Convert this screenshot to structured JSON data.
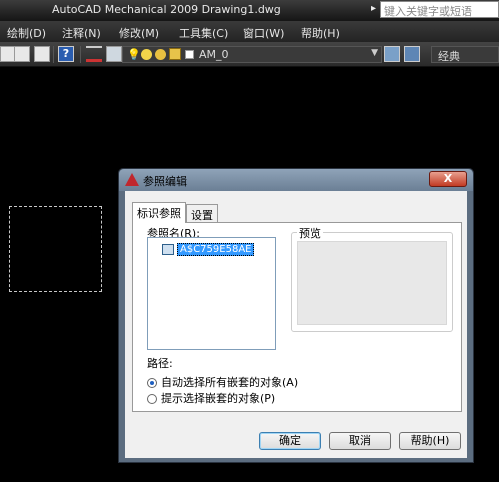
{
  "window": {
    "title": "AutoCAD Mechanical 2009 Drawing1.dwg",
    "search_placeholder": "键入关键字或短语"
  },
  "menubar": {
    "items": [
      "绘制(D)",
      "注释(N)",
      "修改(M)",
      "工具集(C)",
      "窗口(W)",
      "帮助(H)"
    ]
  },
  "toolbar": {
    "layer_name": "AM_0",
    "workspace": "经典"
  },
  "dialog": {
    "title": "参照编辑",
    "close_label": "X",
    "tabs": [
      "标识参照",
      "设置"
    ],
    "active_tab": "标识参照",
    "ref_name_label": "参照名(R):",
    "tree_item": "A$C759E58AE",
    "preview_label": "预览",
    "path_label": "路径:",
    "options": [
      {
        "label": "自动选择所有嵌套的对象(A)",
        "selected": true
      },
      {
        "label": "提示选择嵌套的对象(P)",
        "selected": false
      }
    ],
    "buttons": {
      "ok": "确定",
      "cancel": "取消",
      "help": "帮助(H)"
    }
  }
}
